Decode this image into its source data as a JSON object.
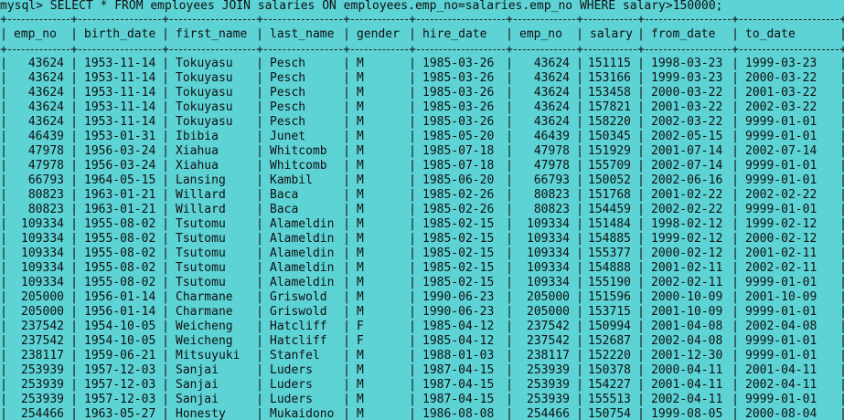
{
  "prompt": "mysql> SELECT * FROM employees JOIN salaries ON employees.emp_no=salaries.emp_no WHERE salary>150000;",
  "columns": [
    "emp_no",
    "birth_date",
    "first_name",
    "last_name",
    "gender",
    "hire_date",
    "emp_no",
    "salary",
    "from_date",
    "to_date"
  ],
  "rows": [
    [
      "43624",
      "1953-11-14",
      "Tokuyasu",
      "Pesch",
      "M",
      "1985-03-26",
      "43624",
      "151115",
      "1998-03-23",
      "1999-03-23"
    ],
    [
      "43624",
      "1953-11-14",
      "Tokuyasu",
      "Pesch",
      "M",
      "1985-03-26",
      "43624",
      "153166",
      "1999-03-23",
      "2000-03-22"
    ],
    [
      "43624",
      "1953-11-14",
      "Tokuyasu",
      "Pesch",
      "M",
      "1985-03-26",
      "43624",
      "153458",
      "2000-03-22",
      "2001-03-22"
    ],
    [
      "43624",
      "1953-11-14",
      "Tokuyasu",
      "Pesch",
      "M",
      "1985-03-26",
      "43624",
      "157821",
      "2001-03-22",
      "2002-03-22"
    ],
    [
      "43624",
      "1953-11-14",
      "Tokuyasu",
      "Pesch",
      "M",
      "1985-03-26",
      "43624",
      "158220",
      "2002-03-22",
      "9999-01-01"
    ],
    [
      "46439",
      "1953-01-31",
      "Ibibia",
      "Junet",
      "M",
      "1985-05-20",
      "46439",
      "150345",
      "2002-05-15",
      "9999-01-01"
    ],
    [
      "47978",
      "1956-03-24",
      "Xiahua",
      "Whitcomb",
      "M",
      "1985-07-18",
      "47978",
      "151929",
      "2001-07-14",
      "2002-07-14"
    ],
    [
      "47978",
      "1956-03-24",
      "Xiahua",
      "Whitcomb",
      "M",
      "1985-07-18",
      "47978",
      "155709",
      "2002-07-14",
      "9999-01-01"
    ],
    [
      "66793",
      "1964-05-15",
      "Lansing",
      "Kambil",
      "M",
      "1985-06-20",
      "66793",
      "150052",
      "2002-06-16",
      "9999-01-01"
    ],
    [
      "80823",
      "1963-01-21",
      "Willard",
      "Baca",
      "M",
      "1985-02-26",
      "80823",
      "151768",
      "2001-02-22",
      "2002-02-22"
    ],
    [
      "80823",
      "1963-01-21",
      "Willard",
      "Baca",
      "M",
      "1985-02-26",
      "80823",
      "154459",
      "2002-02-22",
      "9999-01-01"
    ],
    [
      "109334",
      "1955-08-02",
      "Tsutomu",
      "Alameldin",
      "M",
      "1985-02-15",
      "109334",
      "151484",
      "1998-02-12",
      "1999-02-12"
    ],
    [
      "109334",
      "1955-08-02",
      "Tsutomu",
      "Alameldin",
      "M",
      "1985-02-15",
      "109334",
      "154885",
      "1999-02-12",
      "2000-02-12"
    ],
    [
      "109334",
      "1955-08-02",
      "Tsutomu",
      "Alameldin",
      "M",
      "1985-02-15",
      "109334",
      "155377",
      "2000-02-12",
      "2001-02-11"
    ],
    [
      "109334",
      "1955-08-02",
      "Tsutomu",
      "Alameldin",
      "M",
      "1985-02-15",
      "109334",
      "154888",
      "2001-02-11",
      "2002-02-11"
    ],
    [
      "109334",
      "1955-08-02",
      "Tsutomu",
      "Alameldin",
      "M",
      "1985-02-15",
      "109334",
      "155190",
      "2002-02-11",
      "9999-01-01"
    ],
    [
      "205000",
      "1956-01-14",
      "Charmane",
      "Griswold",
      "M",
      "1990-06-23",
      "205000",
      "151596",
      "2000-10-09",
      "2001-10-09"
    ],
    [
      "205000",
      "1956-01-14",
      "Charmane",
      "Griswold",
      "M",
      "1990-06-23",
      "205000",
      "153715",
      "2001-10-09",
      "9999-01-01"
    ],
    [
      "237542",
      "1954-10-05",
      "Weicheng",
      "Hatcliff",
      "F",
      "1985-04-12",
      "237542",
      "150994",
      "2001-04-08",
      "2002-04-08"
    ],
    [
      "237542",
      "1954-10-05",
      "Weicheng",
      "Hatcliff",
      "F",
      "1985-04-12",
      "237542",
      "152687",
      "2002-04-08",
      "9999-01-01"
    ],
    [
      "238117",
      "1959-06-21",
      "Mitsuyuki",
      "Stanfel",
      "M",
      "1988-01-03",
      "238117",
      "152220",
      "2001-12-30",
      "9999-01-01"
    ],
    [
      "253939",
      "1957-12-03",
      "Sanjai",
      "Luders",
      "M",
      "1987-04-15",
      "253939",
      "150378",
      "2000-04-11",
      "2001-04-11"
    ],
    [
      "253939",
      "1957-12-03",
      "Sanjai",
      "Luders",
      "M",
      "1987-04-15",
      "253939",
      "154227",
      "2001-04-11",
      "2002-04-11"
    ],
    [
      "253939",
      "1957-12-03",
      "Sanjai",
      "Luders",
      "M",
      "1987-04-15",
      "253939",
      "155513",
      "2002-04-11",
      "9999-01-01"
    ],
    [
      "254466",
      "1963-05-27",
      "Honesty",
      "Mukaidono",
      "M",
      "1986-08-08",
      "254466",
      "150754",
      "1999-08-05",
      "2000-08-04"
    ]
  ],
  "colors": {
    "background": "#5dd3d6",
    "text": "#101010"
  }
}
